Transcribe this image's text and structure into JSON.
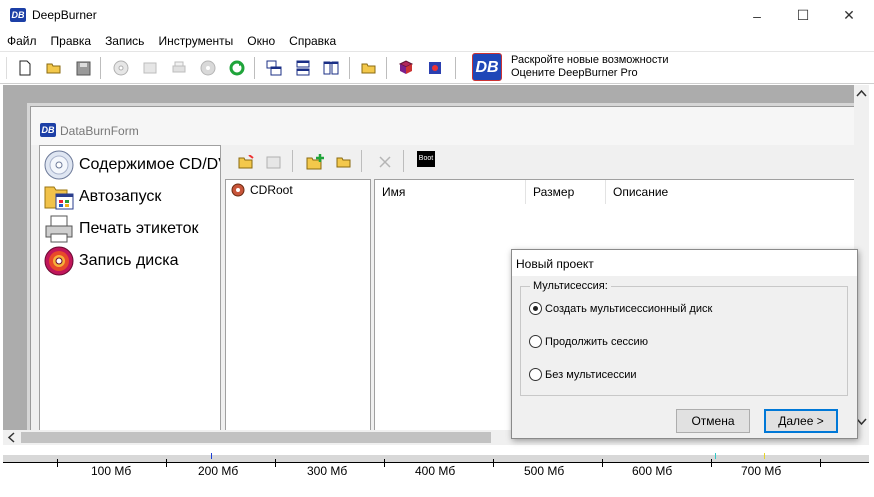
{
  "app": {
    "title": "DeepBurner",
    "logo_text": "DB"
  },
  "window_controls": {
    "minimize": "–",
    "maximize": "☐",
    "close": "✕"
  },
  "menu": [
    "Файл",
    "Правка",
    "Запись",
    "Инструменты",
    "Окно",
    "Справка"
  ],
  "promo": {
    "line1": "Раскройте новые возможности",
    "line2": "Оцените DeepBurner Pro",
    "logo_text": "DB"
  },
  "child": {
    "title": "DataBurnForm",
    "logo_text": "DB",
    "nav": [
      "Содержимое CD/DVD",
      "Автозапуск",
      "Печать этикеток",
      "Запись диска"
    ],
    "tree_root": "CDRoot",
    "columns": [
      "Имя",
      "Размер",
      "Описание"
    ],
    "boot_label": "Boot"
  },
  "ruler": {
    "labels": [
      "100 Мб",
      "200 Мб",
      "300 Мб",
      "400 Мб",
      "500 Мб",
      "600 Мб",
      "700 Мб"
    ]
  },
  "dialog": {
    "title": "Новый проект",
    "group_label": "Мультисессия:",
    "options": [
      "Создать мультисессионный диск",
      "Продолжить сессию",
      "Без мультисессии"
    ],
    "selected_index": 0,
    "cancel": "Отмена",
    "next": "Далее >"
  },
  "colors": {
    "mdi_background": "#acacac",
    "accent": "#0078d7",
    "brand": "#1c3fa6"
  }
}
